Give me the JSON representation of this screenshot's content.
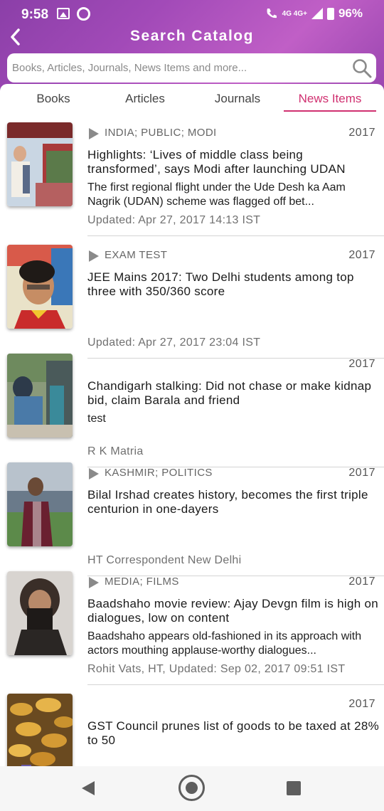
{
  "status_bar": {
    "time": "9:58",
    "network_label": "4G 4G+",
    "battery": "96%"
  },
  "header": {
    "title": "Search Catalog"
  },
  "search": {
    "placeholder": "Books, Articles, Journals, News Items and more..."
  },
  "tabs": [
    {
      "label": "Books",
      "active": false
    },
    {
      "label": "Articles",
      "active": false
    },
    {
      "label": "Journals",
      "active": false
    },
    {
      "label": "News Items",
      "active": true
    }
  ],
  "items": [
    {
      "tags": "INDIA; PUBLIC; MODI",
      "year": "2017",
      "headline": "Highlights: ‘Lives of middle class being transformed’, says Modi after launching UDAN",
      "description": "The first regional flight under the Ude Desh ka Aam Nagrik (UDAN) scheme was flagged off bet...",
      "footer": "Updated: Apr 27, 2017 14:13 IST"
    },
    {
      "tags": "EXAM TEST",
      "year": "2017",
      "headline": "JEE Mains 2017: Two Delhi students among top three with 350/360 score",
      "description": "",
      "footer": "Updated: Apr 27, 2017 23:04 IST"
    },
    {
      "tags": "",
      "year": "2017",
      "headline": "Chandigarh stalking: Did not chase or make kidnap bid, claim Barala and friend",
      "description": "test",
      "footer": "R K Matria"
    },
    {
      "tags": "KASHMIR; POLITICS",
      "year": "2017",
      "headline": "Bilal Irshad creates history, becomes the first triple centurion in one-dayers",
      "description": "",
      "footer": "HT Correspondent New Delhi"
    },
    {
      "tags": "MEDIA; FILMS",
      "year": "2017",
      "headline": "Baadshaho movie review: Ajay Devgn film is high on dialogues, low on content",
      "description": "Baadshaho appears old-fashioned in its approach with actors mouthing applause-worthy dialogues...",
      "footer": "Rohit Vats, HT, Updated: Sep 02, 2017 09:51 IST"
    },
    {
      "tags": "",
      "year": "2017",
      "headline": "GST Council prunes list of goods to be taxed at 28% to 50",
      "description": "",
      "footer": ""
    }
  ],
  "icons": {
    "back": "arrow-back-icon",
    "search": "search-icon",
    "tag": "play-triangle-icon",
    "nav_back": "nav-back-icon",
    "nav_home": "nav-home-icon",
    "nav_recent": "nav-recent-icon"
  },
  "colors": {
    "header_start": "#8b3fa8",
    "header_end": "#c05fc6",
    "accent_tab": "#d03070"
  }
}
